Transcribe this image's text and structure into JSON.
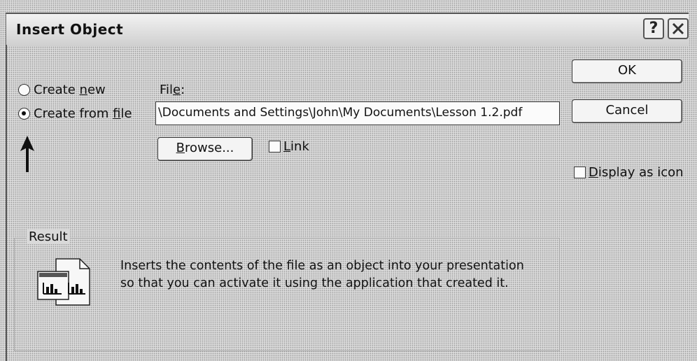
{
  "dialog": {
    "title": "Insert Object",
    "help_button": "?",
    "close_icon": "close-icon"
  },
  "options": {
    "create_new": {
      "prefix": "Create ",
      "accel": "n",
      "suffix": "ew",
      "selected": false
    },
    "create_from_file": {
      "prefix": "Create from ",
      "accel": "f",
      "suffix": "ile",
      "selected": true
    }
  },
  "file": {
    "label_prefix": "Fil",
    "label_accel": "e",
    "label_suffix": ":",
    "value": "\\Documents and Settings\\John\\My Documents\\Lesson 1.2.pdf"
  },
  "browse_button": {
    "accel": "B",
    "rest": "rowse..."
  },
  "link_checkbox": {
    "accel": "L",
    "rest": "ink",
    "checked": false
  },
  "ok_button": "OK",
  "cancel_button": "Cancel",
  "display_as_icon": {
    "accel": "D",
    "rest": "isplay as icon",
    "checked": false
  },
  "result": {
    "label": "Result",
    "line1": "Inserts the contents of the file as an object into your presentation",
    "line2": "so that you can activate it using the application that created it."
  },
  "annotation": {
    "icon": "arrow-up-icon"
  }
}
